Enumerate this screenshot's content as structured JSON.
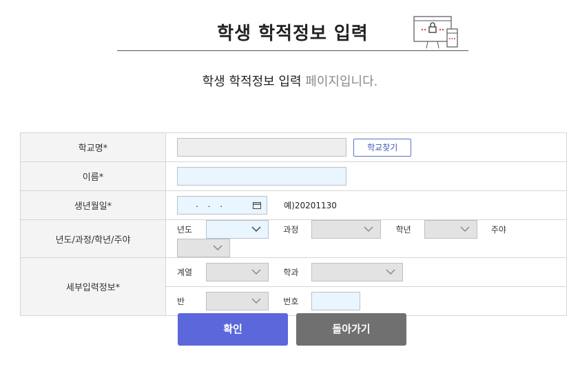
{
  "header": {
    "title": "학생 학적정보 입력",
    "subtitle_main": "학생 학적정보 입력",
    "subtitle_muted": " 페이지입니다."
  },
  "form": {
    "school": {
      "label": "학교명*",
      "value": "",
      "find_button": "학교찾기"
    },
    "name": {
      "label": "이름*",
      "value": ""
    },
    "birth": {
      "label": "생년월일*",
      "placeholder": ". . .",
      "hint": "예)20201130"
    },
    "year_course": {
      "label": "년도/과정/학년/주야",
      "year_label": "년도",
      "course_label": "과정",
      "grade_label": "학년",
      "daynight_label": "주야"
    },
    "detail": {
      "label": "세부입력정보*",
      "series_label": "계열",
      "dept_label": "학과",
      "class_label": "반",
      "number_label": "번호"
    }
  },
  "actions": {
    "confirm": "확인",
    "back": "돌아가기"
  },
  "colors": {
    "primary": "#5b67db",
    "secondary": "#707070",
    "field_blue": "#e9f5ff",
    "field_gray": "#e3e3e3"
  }
}
